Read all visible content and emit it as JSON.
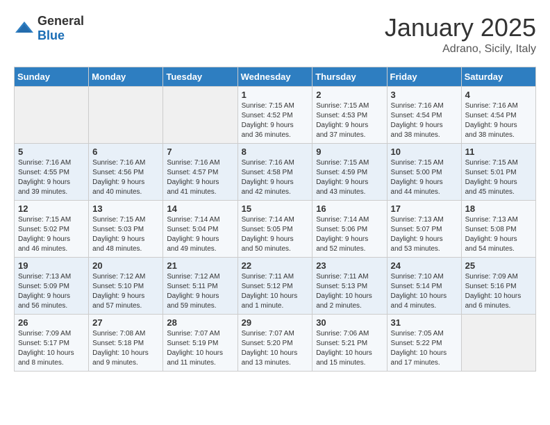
{
  "header": {
    "logo_general": "General",
    "logo_blue": "Blue",
    "month": "January 2025",
    "location": "Adrano, Sicily, Italy"
  },
  "weekdays": [
    "Sunday",
    "Monday",
    "Tuesday",
    "Wednesday",
    "Thursday",
    "Friday",
    "Saturday"
  ],
  "weeks": [
    [
      {
        "day": "",
        "info": ""
      },
      {
        "day": "",
        "info": ""
      },
      {
        "day": "",
        "info": ""
      },
      {
        "day": "1",
        "info": "Sunrise: 7:15 AM\nSunset: 4:52 PM\nDaylight: 9 hours\nand 36 minutes."
      },
      {
        "day": "2",
        "info": "Sunrise: 7:15 AM\nSunset: 4:53 PM\nDaylight: 9 hours\nand 37 minutes."
      },
      {
        "day": "3",
        "info": "Sunrise: 7:16 AM\nSunset: 4:54 PM\nDaylight: 9 hours\nand 38 minutes."
      },
      {
        "day": "4",
        "info": "Sunrise: 7:16 AM\nSunset: 4:54 PM\nDaylight: 9 hours\nand 38 minutes."
      }
    ],
    [
      {
        "day": "5",
        "info": "Sunrise: 7:16 AM\nSunset: 4:55 PM\nDaylight: 9 hours\nand 39 minutes."
      },
      {
        "day": "6",
        "info": "Sunrise: 7:16 AM\nSunset: 4:56 PM\nDaylight: 9 hours\nand 40 minutes."
      },
      {
        "day": "7",
        "info": "Sunrise: 7:16 AM\nSunset: 4:57 PM\nDaylight: 9 hours\nand 41 minutes."
      },
      {
        "day": "8",
        "info": "Sunrise: 7:16 AM\nSunset: 4:58 PM\nDaylight: 9 hours\nand 42 minutes."
      },
      {
        "day": "9",
        "info": "Sunrise: 7:15 AM\nSunset: 4:59 PM\nDaylight: 9 hours\nand 43 minutes."
      },
      {
        "day": "10",
        "info": "Sunrise: 7:15 AM\nSunset: 5:00 PM\nDaylight: 9 hours\nand 44 minutes."
      },
      {
        "day": "11",
        "info": "Sunrise: 7:15 AM\nSunset: 5:01 PM\nDaylight: 9 hours\nand 45 minutes."
      }
    ],
    [
      {
        "day": "12",
        "info": "Sunrise: 7:15 AM\nSunset: 5:02 PM\nDaylight: 9 hours\nand 46 minutes."
      },
      {
        "day": "13",
        "info": "Sunrise: 7:15 AM\nSunset: 5:03 PM\nDaylight: 9 hours\nand 48 minutes."
      },
      {
        "day": "14",
        "info": "Sunrise: 7:14 AM\nSunset: 5:04 PM\nDaylight: 9 hours\nand 49 minutes."
      },
      {
        "day": "15",
        "info": "Sunrise: 7:14 AM\nSunset: 5:05 PM\nDaylight: 9 hours\nand 50 minutes."
      },
      {
        "day": "16",
        "info": "Sunrise: 7:14 AM\nSunset: 5:06 PM\nDaylight: 9 hours\nand 52 minutes."
      },
      {
        "day": "17",
        "info": "Sunrise: 7:13 AM\nSunset: 5:07 PM\nDaylight: 9 hours\nand 53 minutes."
      },
      {
        "day": "18",
        "info": "Sunrise: 7:13 AM\nSunset: 5:08 PM\nDaylight: 9 hours\nand 54 minutes."
      }
    ],
    [
      {
        "day": "19",
        "info": "Sunrise: 7:13 AM\nSunset: 5:09 PM\nDaylight: 9 hours\nand 56 minutes."
      },
      {
        "day": "20",
        "info": "Sunrise: 7:12 AM\nSunset: 5:10 PM\nDaylight: 9 hours\nand 57 minutes."
      },
      {
        "day": "21",
        "info": "Sunrise: 7:12 AM\nSunset: 5:11 PM\nDaylight: 9 hours\nand 59 minutes."
      },
      {
        "day": "22",
        "info": "Sunrise: 7:11 AM\nSunset: 5:12 PM\nDaylight: 10 hours\nand 1 minute."
      },
      {
        "day": "23",
        "info": "Sunrise: 7:11 AM\nSunset: 5:13 PM\nDaylight: 10 hours\nand 2 minutes."
      },
      {
        "day": "24",
        "info": "Sunrise: 7:10 AM\nSunset: 5:14 PM\nDaylight: 10 hours\nand 4 minutes."
      },
      {
        "day": "25",
        "info": "Sunrise: 7:09 AM\nSunset: 5:16 PM\nDaylight: 10 hours\nand 6 minutes."
      }
    ],
    [
      {
        "day": "26",
        "info": "Sunrise: 7:09 AM\nSunset: 5:17 PM\nDaylight: 10 hours\nand 8 minutes."
      },
      {
        "day": "27",
        "info": "Sunrise: 7:08 AM\nSunset: 5:18 PM\nDaylight: 10 hours\nand 9 minutes."
      },
      {
        "day": "28",
        "info": "Sunrise: 7:07 AM\nSunset: 5:19 PM\nDaylight: 10 hours\nand 11 minutes."
      },
      {
        "day": "29",
        "info": "Sunrise: 7:07 AM\nSunset: 5:20 PM\nDaylight: 10 hours\nand 13 minutes."
      },
      {
        "day": "30",
        "info": "Sunrise: 7:06 AM\nSunset: 5:21 PM\nDaylight: 10 hours\nand 15 minutes."
      },
      {
        "day": "31",
        "info": "Sunrise: 7:05 AM\nSunset: 5:22 PM\nDaylight: 10 hours\nand 17 minutes."
      },
      {
        "day": "",
        "info": ""
      }
    ]
  ]
}
